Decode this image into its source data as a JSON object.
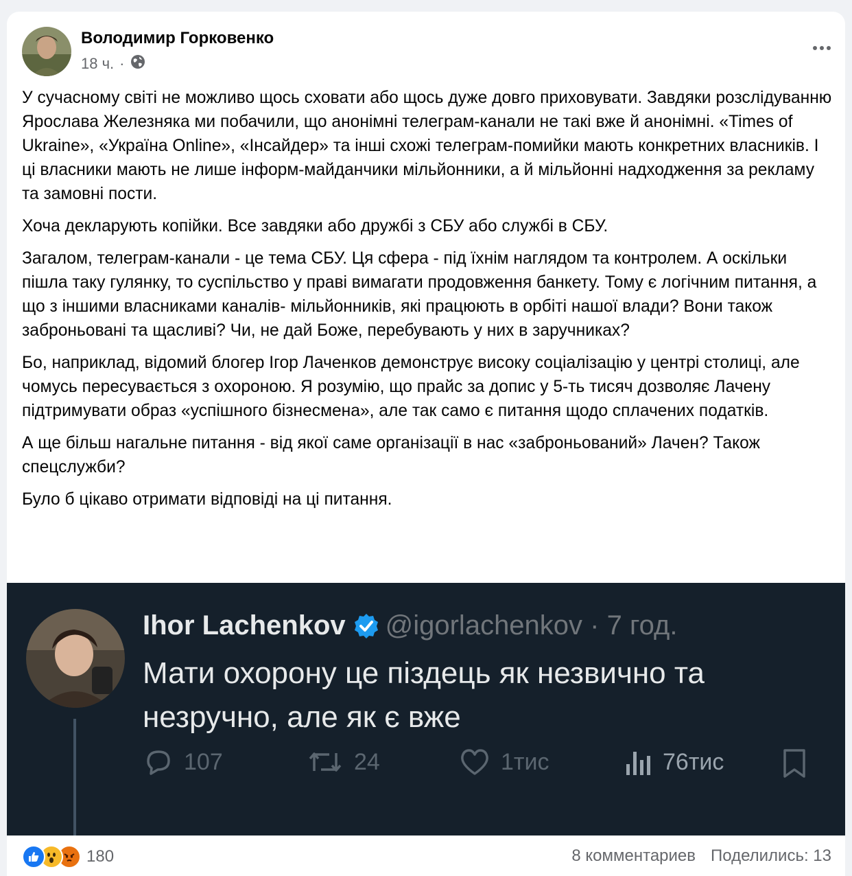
{
  "post": {
    "author": "Володимир Горковенко",
    "time": "18 ч.",
    "separator": "·",
    "paragraphs": [
      "У сучасному світі не можливо щось сховати або щось дуже довго приховувати. Завдяки розслідуванню Ярослава Железняка ми побачили, що анонімні телеграм-канали не такі вже й анонімні. «Times of Ukraine», «Україна Online», «Інсайдер» та інші схожі телеграм-помийки мають конкретних власників. І ці власники мають не лише інформ-майданчики мільйонники, а й мільйонні надходження за рекламу та  замовні пости.",
      "Хоча декларують копійки. Все завдяки або дружбі з СБУ або службі в СБУ.",
      "Загалом, телеграм-канали - це тема СБУ. Ця сфера - під їхнім наглядом та контролем. А оскільки пішла таку гулянку, то суспільство у праві вимагати продовження банкету. Тому є логічним питання, а що з іншими власниками каналів- мільйонників, які працюють в орбіті нашої влади? Вони також заброньовані та щасливі? Чи, не дай Боже, перебувають у них в заручниках?",
      "Бо, наприклад, відомий блогер Ігор Лаченков  демонструє високу соціалізацію у центрі столиці, але чомусь пересувається з охороною. Я розумію, що прайс за допис у 5-ть тисяч дозволяє Лачену підтримувати образ «успішного бізнесмена», але так само є питання щодо сплачених податків.",
      "А ще більш нагальне питання - від якої  саме організації в нас «заброньований» Лачен? Також спецслужби?",
      "Було б цікаво отримати відповіді на ці питання."
    ]
  },
  "tweet": {
    "name": "Ihor Lachenkov",
    "handle": "@igorlachenkov · 7 год.",
    "text": "Мати охорону це піздець як незвично та незручно, але як є вже",
    "replies": "107",
    "retweets": "24",
    "likes": "1тис",
    "views": "76тис"
  },
  "footer": {
    "reaction_count": "180",
    "comments": "8 комментариев",
    "shares": "Поделились: 13"
  },
  "colors": {
    "like_blue": "#1877f2",
    "wow_yellow": "#f7b928",
    "angry_red": "#e9710f",
    "tweet_bg": "#15202b",
    "verified": "#1d9bf0"
  },
  "icons": [
    "globe-icon",
    "more-icon",
    "verified-icon",
    "reply-icon",
    "retweet-icon",
    "like-icon",
    "views-icon",
    "bookmark-icon",
    "like-reaction-icon",
    "wow-reaction-icon",
    "angry-reaction-icon"
  ]
}
